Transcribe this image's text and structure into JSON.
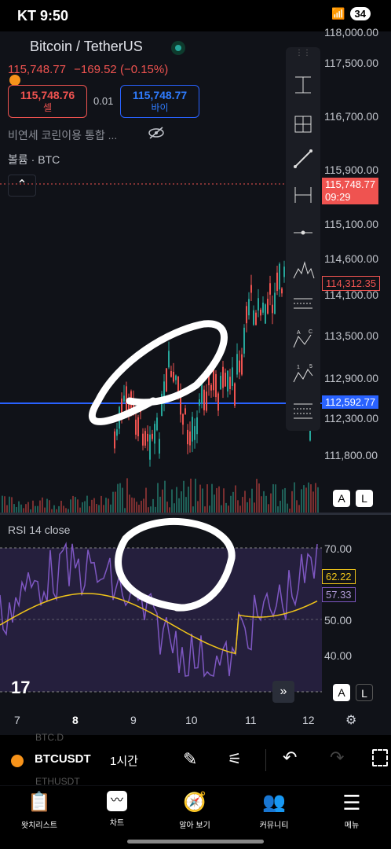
{
  "status": {
    "carrier": "KT",
    "time": "9:50",
    "battery": "34"
  },
  "symbol": {
    "name": "Bitcoin / TetherUS",
    "price": "115,748.77",
    "change": "−169.52 (−0.15%)"
  },
  "trade": {
    "sell_price": "115,748.76",
    "sell_label": "셀",
    "spread": "0.01",
    "buy_price": "115,748.77",
    "buy_label": "바이"
  },
  "overlay_text": "비연세 코린이용 통합 ...",
  "volume_label": "볼륨 · BTC",
  "price_axis": [
    "118,000.00",
    "117,500.00",
    "116,700.00",
    "115,900.00",
    "115,100.00",
    "114,600.00",
    "114,100.00",
    "113,500.00",
    "112,900.00",
    "112,300.00",
    "111,800.00"
  ],
  "price_tags": {
    "current": "115,748.77",
    "countdown": "09:29",
    "high_tag": "114,312.35",
    "line_tag": "112,592.77"
  },
  "rsi": {
    "label": "RSI 14 close",
    "levels": [
      "70.00",
      "50.00",
      "40.00"
    ],
    "value_ma": "62.22",
    "value_rsi": "57.33"
  },
  "x_axis": [
    "7",
    "8",
    "9",
    "10",
    "11",
    "12"
  ],
  "scale_buttons": {
    "auto": "A",
    "log": "L"
  },
  "toolbar": {
    "ticker": "BTCUSDT",
    "interval": "1시간",
    "ticker_behind_1": "BTC.D",
    "ticker_behind_2": "ETHUSDT"
  },
  "nav": [
    {
      "label": "왓치리스트",
      "icon": "watchlist-icon"
    },
    {
      "label": "차트",
      "icon": "chart-icon"
    },
    {
      "label": "알아 보기",
      "icon": "compass-icon"
    },
    {
      "label": "커뮤니티",
      "icon": "community-icon"
    },
    {
      "label": "메뉴",
      "icon": "menu-icon"
    }
  ],
  "colors": {
    "up": "#26a69a",
    "down": "#ef5350",
    "rsi": "#7e57c2",
    "rsi_ma": "#f0c419",
    "blue_line": "#2962ff"
  }
}
